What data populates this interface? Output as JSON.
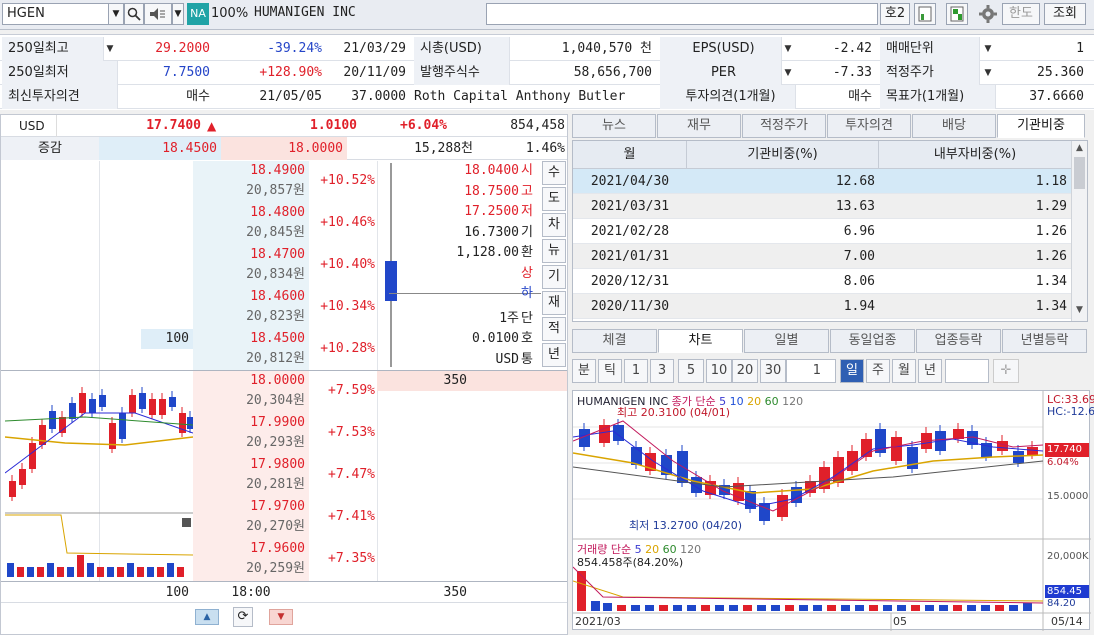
{
  "topbar": {
    "code": "HGEN",
    "badge": "NA",
    "pct": "100%",
    "name": "HUMANIGEN INC",
    "btn_ho": "호2",
    "btn_hando": "한도",
    "btn_jo": "조회"
  },
  "info": {
    "r1": {
      "l1": "250일최고",
      "v1": "29.2000",
      "c1": "-39.24%",
      "d1": "21/03/29",
      "l2": "시총(USD)",
      "v2": "1,040,570 천",
      "l3": "EPS(USD)",
      "v3": "-2.42",
      "l4": "매매단위",
      "v4": "1"
    },
    "r2": {
      "l1": "250일최저",
      "v1": "7.7500",
      "c1": "+128.90%",
      "d1": "20/11/09",
      "l2": "발행주식수",
      "v2": "58,656,700",
      "l3": "PER",
      "v3": "-7.33",
      "l4": "적정주가",
      "v4": "25.360"
    },
    "r3": {
      "l1": "최신투자의견",
      "v1": "매수",
      "d1": "21/05/05",
      "p1": "37.0000",
      "firm": "Roth Capital Anthony Butler",
      "l3": "투자의견(1개월)",
      "v3": "매수",
      "l4": "목표가(1개월)",
      "v4": "37.6660"
    }
  },
  "quote": {
    "cur": "USD",
    "price": "17.7400",
    "arrow": "▲",
    "change": "1.0100",
    "rate": "+6.04%",
    "volume": "854,458",
    "label2": "증감",
    "p1": "18.4500",
    "p2": "18.0000",
    "amt": "15,288천",
    "ratio": "1.46%"
  },
  "asks": [
    {
      "price": "18.4900",
      "won": "20,857원",
      "rate": "+10.52%"
    },
    {
      "price": "18.4800",
      "won": "20,845원",
      "rate": "+10.46%"
    },
    {
      "price": "18.4700",
      "won": "20,834원",
      "rate": "+10.40%"
    },
    {
      "price": "18.4600",
      "won": "20,823원",
      "rate": "+10.34%"
    },
    {
      "price": "18.4500",
      "won": "20,812원",
      "rate": "+10.28%",
      "qty": "100"
    }
  ],
  "bids": [
    {
      "price": "18.0000",
      "won": "20,304원",
      "rate": "+7.59%",
      "qty": "350"
    },
    {
      "price": "17.9900",
      "won": "20,293원",
      "rate": "+7.53%"
    },
    {
      "price": "17.9800",
      "won": "20,281원",
      "rate": "+7.47%"
    },
    {
      "price": "17.9700",
      "won": "20,270원",
      "rate": "+7.41%"
    },
    {
      "price": "17.9600",
      "won": "20,259원",
      "rate": "+7.35%"
    }
  ],
  "ohlc": [
    {
      "v": "18.0400",
      "k": "시"
    },
    {
      "v": "18.7500",
      "k": "고"
    },
    {
      "v": "17.2500",
      "k": "저"
    },
    {
      "v": "16.7300",
      "k": "기"
    },
    {
      "v": "1,128.00",
      "k": "환"
    },
    {
      "v": "",
      "k": "상"
    },
    {
      "v": "",
      "k": "하"
    },
    {
      "v": "1주",
      "k": "단"
    },
    {
      "v": "0.0100",
      "k": "호"
    },
    {
      "v": "USD",
      "k": "통"
    }
  ],
  "side_btns": [
    "수",
    "도",
    "차",
    "뉴",
    "기",
    "재",
    "적",
    "년"
  ],
  "footer": {
    "ask_total": "100",
    "time": "18:00",
    "bid_total": "350"
  },
  "right_tabs": [
    "뉴스",
    "재무",
    "적정주가",
    "투자의견",
    "배당",
    "기관비중"
  ],
  "grid": {
    "h1": "월",
    "h2": "기관비중(%)",
    "h3": "내부자비중(%)",
    "rows": [
      {
        "m": "2021/04/30",
        "a": "12.68",
        "b": "1.18"
      },
      {
        "m": "2021/03/31",
        "a": "13.63",
        "b": "1.29"
      },
      {
        "m": "2021/02/28",
        "a": "6.96",
        "b": "1.26"
      },
      {
        "m": "2021/01/31",
        "a": "7.00",
        "b": "1.26"
      },
      {
        "m": "2020/12/31",
        "a": "8.06",
        "b": "1.34"
      },
      {
        "m": "2020/11/30",
        "a": "1.94",
        "b": "1.34"
      }
    ]
  },
  "chart_tabs": [
    "체결",
    "차트",
    "일별",
    "동일업종",
    "업종등락",
    "년별등락"
  ],
  "chart_ctl": [
    "분",
    "틱",
    "1",
    "3",
    "5",
    "10",
    "20",
    "30",
    "1",
    "일",
    "주",
    "월",
    "년"
  ],
  "chart": {
    "title": "HUMANIGEN INC",
    "ma_label": "종가 단순",
    "ma": [
      "5",
      "10",
      "20",
      "60",
      "120"
    ],
    "high": "최고 20.3100 (04/01)",
    "low": "최저 13.2700 (04/20)",
    "lc": "LC:33.69",
    "hc": "HC:-12.6",
    "price_tag": "17.740",
    "pct_tag": "6.04%",
    "y1": "15.0000",
    "vol_title": "거래량 단순",
    "vol_ma": [
      "5",
      "20",
      "60",
      "120"
    ],
    "vol_note": "854.458주(84.20%)",
    "vy": "20,000K",
    "vtag": "854.45",
    "vpct": "84.20",
    "x1": "2021/03",
    "x2": "05",
    "x3": "05/14"
  }
}
